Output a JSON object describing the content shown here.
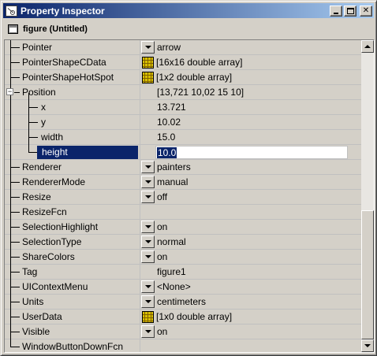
{
  "window": {
    "title": "Property Inspector",
    "minimize_label": "_",
    "maximize_label": "□",
    "close_label": "✕"
  },
  "header": {
    "object_label": "figure (Untitled)"
  },
  "properties": [
    {
      "name": "Pointer",
      "value": "arrow",
      "editor": "dropdown"
    },
    {
      "name": "PointerShapeCData",
      "value": "[16x16  double array]",
      "editor": "array"
    },
    {
      "name": "PointerShapeHotSpot",
      "value": "[1x2  double array]",
      "editor": "array"
    },
    {
      "name": "Position",
      "value": "[13,721 10,02 15 10]",
      "editor": "none",
      "expanded": true
    },
    {
      "name": "x",
      "value": "13.721",
      "editor": "none",
      "child": true
    },
    {
      "name": "y",
      "value": "10.02",
      "editor": "none",
      "child": true
    },
    {
      "name": "width",
      "value": "15.0",
      "editor": "none",
      "child": true
    },
    {
      "name": "height",
      "value": "10.0",
      "editor": "text",
      "child": true,
      "selected": true
    },
    {
      "name": "Renderer",
      "value": "painters",
      "editor": "dropdown"
    },
    {
      "name": "RendererMode",
      "value": "manual",
      "editor": "dropdown"
    },
    {
      "name": "Resize",
      "value": "off",
      "editor": "dropdown"
    },
    {
      "name": "ResizeFcn",
      "value": "",
      "editor": "none"
    },
    {
      "name": "SelectionHighlight",
      "value": "on",
      "editor": "dropdown"
    },
    {
      "name": "SelectionType",
      "value": "normal",
      "editor": "dropdown"
    },
    {
      "name": "ShareColors",
      "value": "on",
      "editor": "dropdown"
    },
    {
      "name": "Tag",
      "value": "figure1",
      "editor": "none"
    },
    {
      "name": "UIContextMenu",
      "value": "<None>",
      "editor": "dropdown"
    },
    {
      "name": "Units",
      "value": "centimeters",
      "editor": "dropdown"
    },
    {
      "name": "UserData",
      "value": "[1x0  double array]",
      "editor": "array"
    },
    {
      "name": "Visible",
      "value": "on",
      "editor": "dropdown"
    },
    {
      "name": "WindowButtonDownFcn",
      "value": "",
      "editor": "none"
    }
  ],
  "colors": {
    "selection": "#0a246a",
    "title_gradient_start": "#0a246a",
    "title_gradient_end": "#a6caf0",
    "face": "#d4d0c8"
  }
}
